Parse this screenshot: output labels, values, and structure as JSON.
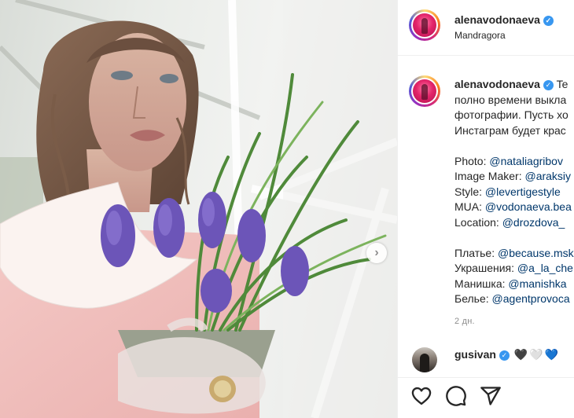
{
  "post": {
    "author": "alenavodonaeva",
    "location": "Mandragora",
    "next_glyph": "›",
    "caption": {
      "first_line": "Te",
      "lines": [
        "полно времени выкла",
        "фотографии. Пусть хо",
        "Инстаграм будет крас"
      ],
      "credits": [
        {
          "label": "Photo: ",
          "handle": "@nataliagribov"
        },
        {
          "label": "Image Maker: ",
          "handle": "@araksiy"
        },
        {
          "label": "Style: ",
          "handle": "@levertigestyle"
        },
        {
          "label": "MUA: ",
          "handle": "@vodonaeva.bea"
        },
        {
          "label": "Location: ",
          "handle": "@drozdova_"
        }
      ],
      "credits2": [
        {
          "label": "Платье: ",
          "handle": "@because.msk"
        },
        {
          "label": "Украшения: ",
          "handle": "@a_la_che"
        },
        {
          "label": "Манишка: ",
          "handle": "@manishka"
        },
        {
          "label": "Белье: ",
          "handle": "@agentprovoca"
        }
      ],
      "time": "2 дн."
    },
    "comment": {
      "user": "gusivan",
      "hearts": [
        "🖤",
        "🤍",
        "💙"
      ]
    }
  },
  "icons": {
    "verified": "✓",
    "like": "heart-icon",
    "comment": "comment-icon",
    "share": "share-icon"
  },
  "colors": {
    "link": "#00376b",
    "verified": "#3897f0",
    "muted": "#8e8e8e"
  }
}
